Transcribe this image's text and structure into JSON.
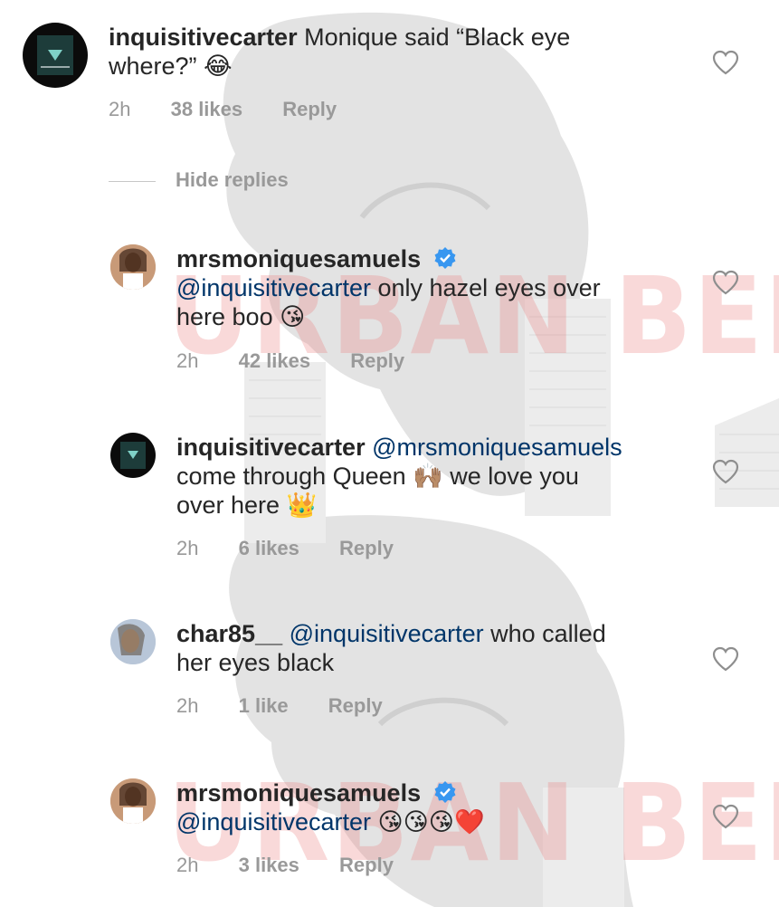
{
  "watermark_text": "URBAN BELLE",
  "hide_replies_label": "Hide replies",
  "colors": {
    "username": "#262626",
    "mention": "#003569",
    "meta": "#999999",
    "verified": "#3897f0",
    "heart_outline": "#8e8e8e"
  },
  "comments": [
    {
      "username": "inquisitivecarter",
      "mention": "",
      "body_line1": " Monique said “Black eye",
      "body_line2": "where?” 😂",
      "body_line3": "",
      "time": "2h",
      "likes": "38 likes",
      "reply": "Reply",
      "avatar": "logo-avatar",
      "verified": false
    },
    {
      "username": "mrsmoniquesamuels",
      "mention": "@inquisitivecarter",
      "body_line1": "",
      "body_line2": " only hazel eyes over",
      "body_line3": "here boo 😘",
      "time": "2h",
      "likes": "42 likes",
      "reply": "Reply",
      "avatar": "photo-avatar",
      "verified": true
    },
    {
      "username": "inquisitivecarter",
      "mention": "@mrsmoniquesamuels",
      "body_line1": "",
      "body_line2": "come through Queen 🙌🏽 we love you",
      "body_line3": "over here 👑",
      "time": "2h",
      "likes": "6 likes",
      "reply": "Reply",
      "avatar": "logo-avatar",
      "verified": false
    },
    {
      "username": "char85__",
      "mention": "@inquisitivecarter",
      "body_line1": " who called",
      "body_line2": "her eyes black",
      "body_line3": "",
      "time": "2h",
      "likes": "1 like",
      "reply": "Reply",
      "avatar": "char-avatar",
      "verified": false
    },
    {
      "username": "mrsmoniquesamuels",
      "mention": "@inquisitivecarter",
      "body_line1": "",
      "body_line2": " 😘😘😘❤️",
      "body_line3": "",
      "time": "2h",
      "likes": "3 likes",
      "reply": "Reply",
      "avatar": "photo-avatar",
      "verified": true
    }
  ]
}
